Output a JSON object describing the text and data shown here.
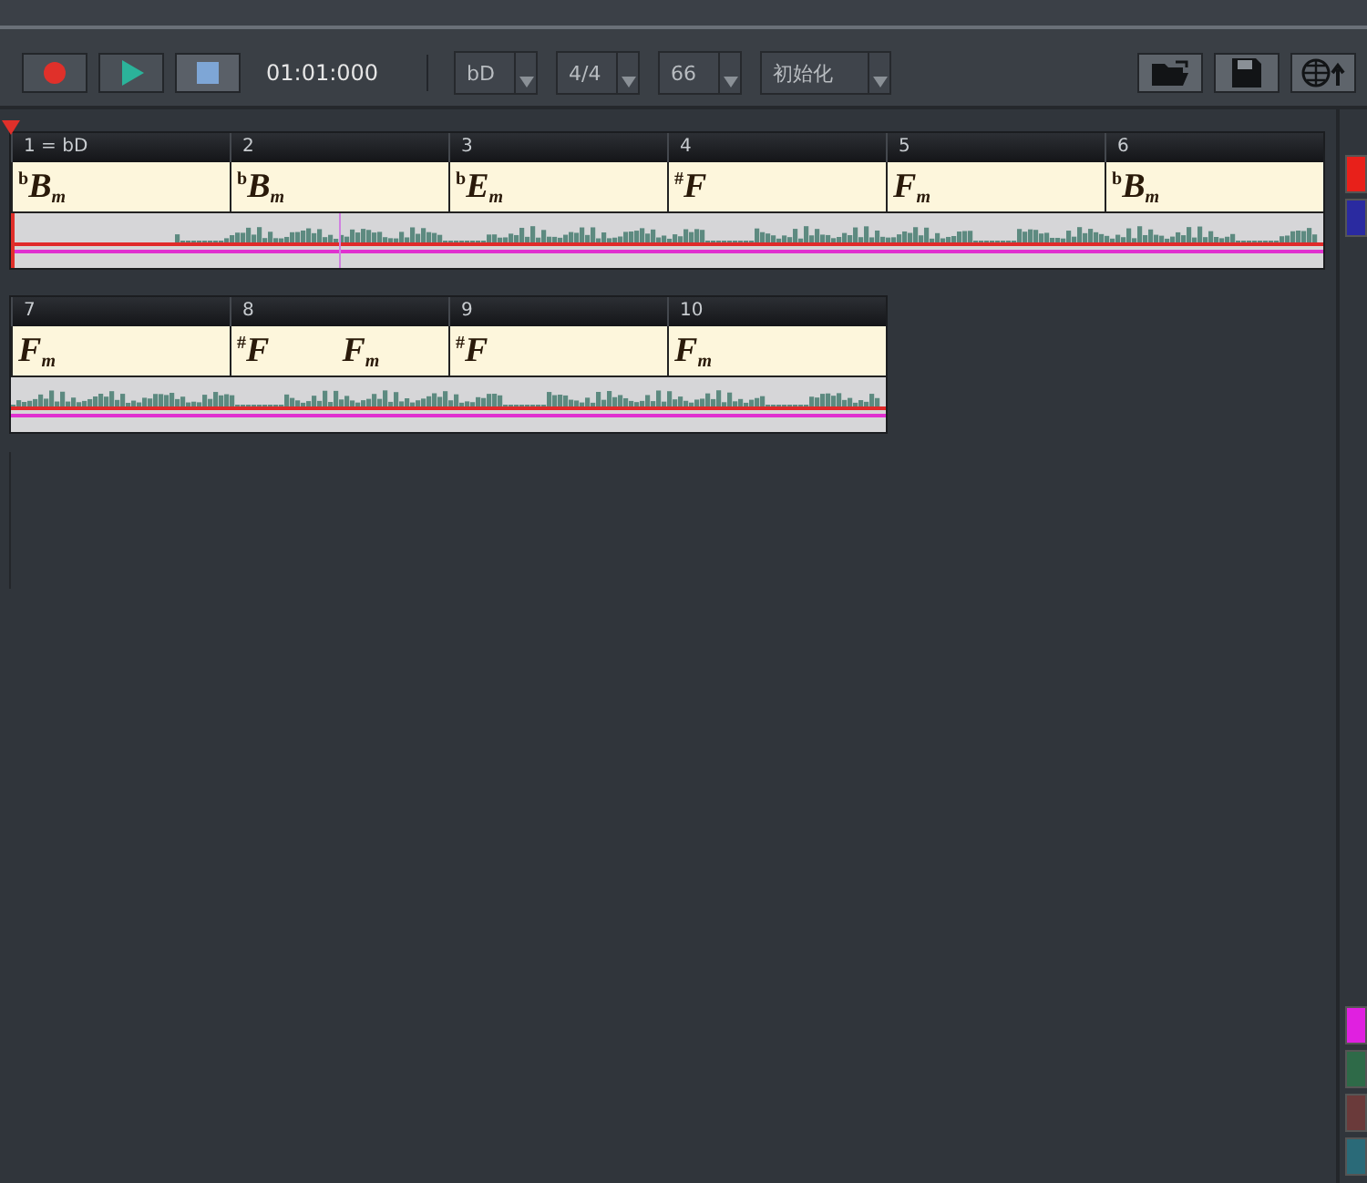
{
  "transport": {
    "time": "01:01:000"
  },
  "selectors": [
    {
      "value": "bD"
    },
    {
      "value": "4/4"
    },
    {
      "value": "66"
    },
    {
      "value": "初始化"
    }
  ],
  "rows": [
    {
      "measures": [
        {
          "label": "1 = bD",
          "chords": [
            {
              "accidental": "b",
              "root": "B",
              "quality": "m"
            }
          ]
        },
        {
          "label": "2",
          "chords": [
            {
              "accidental": "b",
              "root": "B",
              "quality": "m"
            }
          ]
        },
        {
          "label": "3",
          "chords": [
            {
              "accidental": "b",
              "root": "E",
              "quality": "m"
            }
          ]
        },
        {
          "label": "4",
          "chords": [
            {
              "accidental": "#",
              "root": "F"
            }
          ]
        },
        {
          "label": "5",
          "chords": [
            {
              "root": "F",
              "quality": "m"
            }
          ]
        },
        {
          "label": "6",
          "chords": [
            {
              "accidental": "b",
              "root": "B",
              "quality": "m"
            }
          ]
        }
      ]
    },
    {
      "measures": [
        {
          "label": "7",
          "chords": [
            {
              "root": "F",
              "quality": "m"
            }
          ]
        },
        {
          "label": "8",
          "chords": [
            {
              "accidental": "#",
              "root": "F"
            },
            {
              "root": "F",
              "quality": "m"
            }
          ]
        },
        {
          "label": "9",
          "chords": [
            {
              "accidental": "#",
              "root": "F"
            }
          ]
        },
        {
          "label": "10",
          "chords": [
            {
              "root": "F",
              "quality": "m"
            }
          ]
        }
      ]
    }
  ],
  "side_swatches_top": [
    {
      "color": "#e8201a"
    },
    {
      "color": "#2a2aa0"
    }
  ],
  "side_swatches_bottom": [
    {
      "color": "#e020e0"
    },
    {
      "color": "#2e6a48"
    },
    {
      "color": "#6a3a3a"
    },
    {
      "color": "#2a6a78"
    }
  ]
}
